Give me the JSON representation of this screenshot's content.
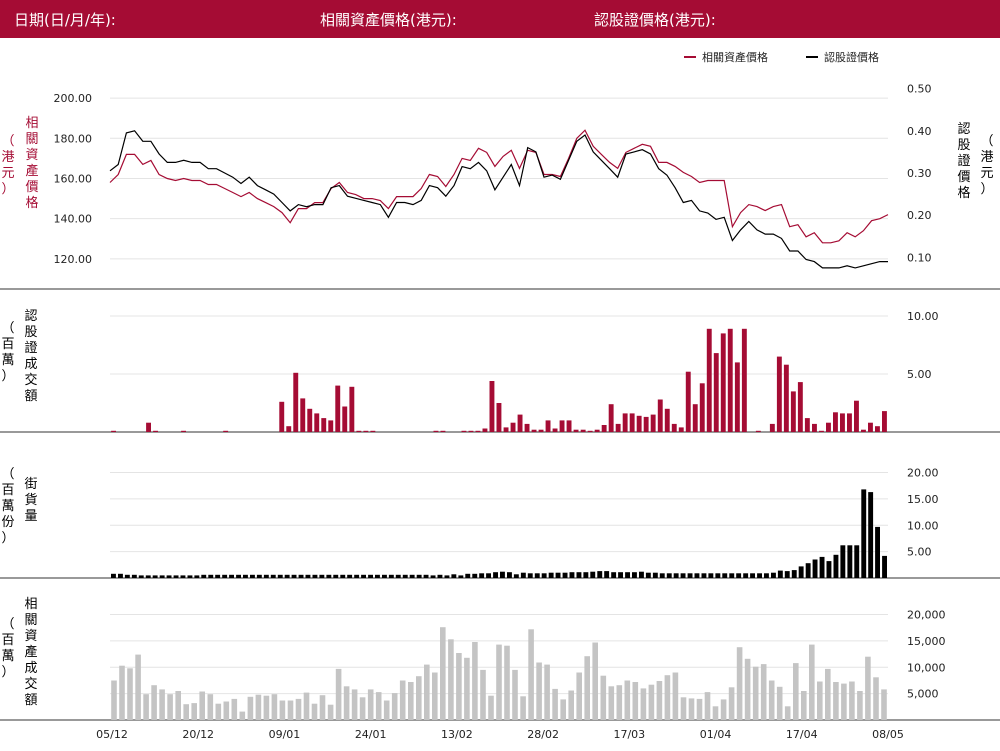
{
  "header": {
    "date_label": "日期(日/月/年):",
    "underlying_label": "相關資產價格(港元):",
    "warrant_label": "認股證價格(港元):"
  },
  "colors": {
    "header_bg": "#a50c34",
    "underlying": "#a50c34",
    "warrant": "#000000",
    "turnover_bar": "#c4c4c4"
  },
  "legend": {
    "underlying": "相關資產價格",
    "warrant": "認股證價格"
  },
  "x_ticks": [
    "05/12",
    "20/12",
    "09/01",
    "24/01",
    "13/02",
    "28/02",
    "17/03",
    "01/04",
    "17/04",
    "08/05"
  ],
  "chart_data": [
    {
      "type": "line",
      "left_ylabel": "相關資產價格",
      "left_yunit": "（港元）",
      "right_ylabel": "認股證價格",
      "right_yunit": "（港元）",
      "left_ylim": [
        105,
        210
      ],
      "right_ylim": [
        0.025,
        0.525
      ],
      "left_ticks": [
        "200.00",
        "180.00",
        "160.00",
        "140.00",
        "120.00"
      ],
      "right_ticks": [
        "0.50",
        "0.40",
        "0.30",
        "0.20",
        "0.10"
      ],
      "legend_position": "top-right",
      "series": [
        {
          "name": "相關資產價格",
          "axis": "left",
          "values": [
            158,
            162,
            172,
            172,
            167,
            169,
            162,
            160,
            159,
            160,
            159,
            159,
            157,
            157,
            155,
            153,
            151,
            153,
            150,
            148,
            146,
            143,
            138,
            145,
            145,
            148,
            148,
            155,
            158,
            153,
            152,
            150,
            150,
            149,
            145,
            151,
            151,
            151,
            155,
            162,
            161,
            156,
            162,
            170,
            169,
            175,
            173,
            166,
            171,
            174,
            165,
            174,
            173,
            162,
            162,
            161,
            170,
            180,
            184,
            176,
            172,
            168,
            165,
            173,
            175,
            177,
            176,
            168,
            168,
            166,
            163,
            161,
            158,
            159,
            159,
            159,
            136,
            143,
            147,
            146,
            144,
            146,
            147,
            136,
            137,
            131,
            133,
            128,
            128,
            129,
            133,
            131,
            134,
            139,
            140,
            142
          ]
        },
        {
          "name": "認股證價格",
          "axis": "right",
          "values": [
            0.305,
            0.32,
            0.395,
            0.4,
            0.375,
            0.375,
            0.345,
            0.325,
            0.325,
            0.33,
            0.325,
            0.325,
            0.31,
            0.31,
            0.3,
            0.29,
            0.275,
            0.29,
            0.27,
            0.26,
            0.25,
            0.23,
            0.21,
            0.225,
            0.22,
            0.225,
            0.225,
            0.265,
            0.27,
            0.245,
            0.24,
            0.235,
            0.23,
            0.225,
            0.195,
            0.23,
            0.23,
            0.225,
            0.235,
            0.27,
            0.265,
            0.245,
            0.27,
            0.315,
            0.31,
            0.325,
            0.305,
            0.26,
            0.29,
            0.32,
            0.27,
            0.36,
            0.35,
            0.29,
            0.295,
            0.285,
            0.33,
            0.375,
            0.39,
            0.35,
            0.33,
            0.31,
            0.29,
            0.345,
            0.35,
            0.355,
            0.345,
            0.31,
            0.295,
            0.265,
            0.23,
            0.235,
            0.21,
            0.205,
            0.19,
            0.195,
            0.14,
            0.165,
            0.185,
            0.165,
            0.155,
            0.155,
            0.145,
            0.115,
            0.115,
            0.095,
            0.09,
            0.075,
            0.075,
            0.075,
            0.08,
            0.075,
            0.08,
            0.085,
            0.09,
            0.09
          ]
        }
      ]
    },
    {
      "type": "bar",
      "ylabel": "認股證成交額",
      "yunit": "（百萬）",
      "ylim": [
        0,
        10
      ],
      "ticks": [
        "10.00",
        "5.00"
      ],
      "values": [
        0.1,
        0,
        0,
        0,
        0,
        0.8,
        0.1,
        0,
        0,
        0,
        0.1,
        0,
        0,
        0,
        0,
        0,
        0.1,
        0,
        0,
        0,
        0,
        0,
        0,
        0,
        2.6,
        0.5,
        5.1,
        2.9,
        2.0,
        1.6,
        1.2,
        1.0,
        4.0,
        2.2,
        3.9,
        0.1,
        0.1,
        0.1,
        0,
        0,
        0,
        0,
        0,
        0,
        0,
        0,
        0.1,
        0.1,
        0,
        0,
        0.1,
        0.1,
        0.1,
        0.3,
        4.4,
        2.5,
        0.4,
        0.8,
        1.5,
        0.7,
        0.2,
        0.2,
        1.0,
        0.3,
        1.0,
        1.0,
        0.2,
        0.2,
        0.1,
        0.2,
        0.6,
        2.4,
        0.7,
        1.6,
        1.6,
        1.4,
        1.3,
        1.5,
        2.8,
        2.0,
        0.7,
        0.4,
        5.2,
        2.4,
        4.2,
        8.9,
        6.8,
        8.5,
        8.9,
        6.0,
        8.9,
        0,
        0.1,
        0,
        0.7,
        6.5,
        5.8,
        3.5,
        4.3,
        1.2,
        0.7,
        0.1,
        0.8,
        1.7,
        1.6,
        1.6,
        2.7,
        0.2,
        0.8,
        0.5,
        1.8
      ]
    },
    {
      "type": "bar",
      "ylabel": "街貨量",
      "yunit": "（百萬份）",
      "ylim": [
        0,
        22
      ],
      "ticks": [
        "20.00",
        "15.00",
        "10.00",
        "5.00"
      ],
      "values": [
        0.8,
        0.8,
        0.6,
        0.6,
        0.5,
        0.5,
        0.5,
        0.5,
        0.5,
        0.5,
        0.5,
        0.5,
        0.5,
        0.6,
        0.6,
        0.6,
        0.6,
        0.6,
        0.6,
        0.6,
        0.6,
        0.6,
        0.6,
        0.6,
        0.6,
        0.6,
        0.6,
        0.6,
        0.6,
        0.6,
        0.6,
        0.6,
        0.6,
        0.6,
        0.6,
        0.6,
        0.6,
        0.6,
        0.6,
        0.6,
        0.6,
        0.6,
        0.6,
        0.6,
        0.6,
        0.6,
        0.5,
        0.6,
        0.5,
        0.7,
        0.5,
        0.8,
        0.8,
        0.9,
        0.9,
        1.1,
        1.2,
        1.1,
        0.7,
        1.0,
        0.9,
        0.9,
        0.9,
        1.0,
        1.0,
        1.0,
        1.1,
        1.1,
        1.1,
        1.2,
        1.3,
        1.3,
        1.1,
        1.1,
        1.1,
        1.1,
        1.2,
        1.0,
        1.0,
        0.9,
        0.9,
        0.9,
        0.9,
        0.9,
        0.9,
        0.9,
        0.9,
        0.9,
        0.9,
        0.9,
        0.9,
        0.9,
        0.9,
        0.9,
        0.9,
        1.0,
        1.4,
        1.3,
        1.5,
        2.2,
        2.8,
        3.5,
        4.0,
        3.2,
        4.4,
        6.2,
        6.2,
        6.2,
        16.8,
        16.3,
        9.7,
        4.2
      ]
    },
    {
      "type": "bar",
      "ylabel": "相關資產成交額",
      "yunit": "（百萬）",
      "ylim": [
        0,
        22000
      ],
      "ticks": [
        "20,000",
        "15,000",
        "10,000",
        "5,000"
      ],
      "values": [
        7500,
        10300,
        9800,
        12400,
        4900,
        6600,
        5800,
        4900,
        5500,
        3000,
        3200,
        5400,
        4900,
        3100,
        3500,
        4000,
        1600,
        4400,
        4800,
        4600,
        4900,
        3700,
        3700,
        4000,
        5200,
        3100,
        4700,
        2900,
        9700,
        6400,
        5800,
        4300,
        5800,
        5300,
        3700,
        5100,
        7500,
        7200,
        8300,
        10500,
        9000,
        17600,
        15300,
        12700,
        11800,
        14800,
        9500,
        4600,
        14300,
        14100,
        9500,
        4500,
        17200,
        10900,
        10500,
        5900,
        3900,
        5600,
        9000,
        12100,
        14700,
        8400,
        6400,
        6600,
        7500,
        7200,
        6000,
        6700,
        7400,
        8500,
        9000,
        4300,
        4100,
        4000,
        5300,
        2600,
        3900,
        6200,
        13800,
        11600,
        10100,
        10600,
        7500,
        6300,
        2600,
        10800,
        5500,
        14300,
        7300,
        9700,
        7200,
        6900,
        7300,
        5500,
        12000,
        8100,
        5800
      ]
    }
  ]
}
